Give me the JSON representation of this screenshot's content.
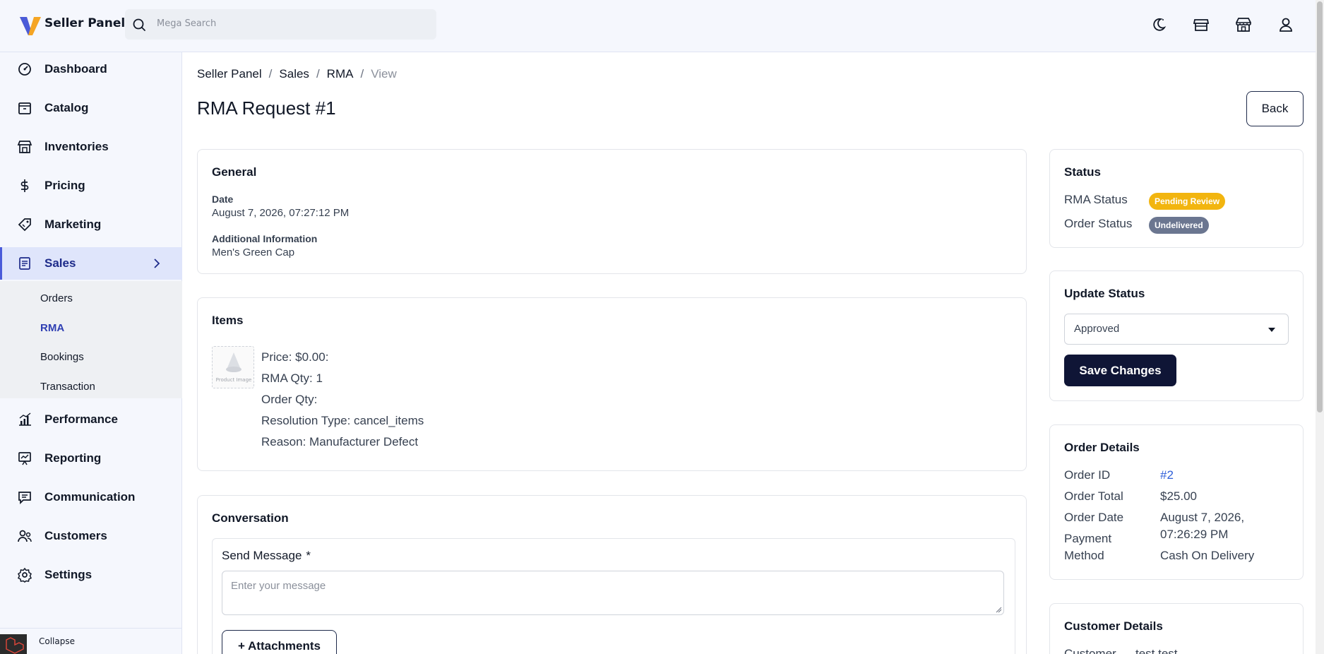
{
  "app": {
    "brand": "Seller Panel"
  },
  "search": {
    "placeholder": "Mega Search"
  },
  "sidebar": {
    "items": [
      {
        "label": "Dashboard"
      },
      {
        "label": "Catalog"
      },
      {
        "label": "Inventories"
      },
      {
        "label": "Pricing"
      },
      {
        "label": "Marketing"
      },
      {
        "label": "Sales"
      },
      {
        "label": "Performance"
      },
      {
        "label": "Reporting"
      },
      {
        "label": "Communication"
      },
      {
        "label": "Customers"
      },
      {
        "label": "Settings"
      }
    ],
    "sub_items": [
      {
        "label": "Orders"
      },
      {
        "label": "RMA"
      },
      {
        "label": "Bookings"
      },
      {
        "label": "Transaction"
      }
    ],
    "collapse_label": "Collapse"
  },
  "breadcrumb": [
    "Seller Panel",
    "Sales",
    "RMA",
    "View"
  ],
  "page": {
    "title": "RMA Request #1",
    "back_label": "Back"
  },
  "general": {
    "title": "General",
    "date_label": "Date",
    "date_value": "August 7, 2026, 07:27:12 PM",
    "info_label": "Additional Information",
    "info_value": "Men's Green Cap"
  },
  "items": {
    "title": "Items",
    "image_placeholder": "Product Image",
    "price": "Price: $0.00:",
    "rma_qty": "RMA Qty: 1",
    "order_qty": "Order Qty:",
    "resolution": "Resolution Type: cancel_items",
    "reason": "Reason: Manufacturer Defect"
  },
  "conversation": {
    "title": "Conversation",
    "send_label": "Send Message",
    "required_mark": "*",
    "placeholder": "Enter your message",
    "attach_label": "+ Attachments"
  },
  "status": {
    "title": "Status",
    "rma_label": "RMA Status",
    "rma_value": "Pending Review",
    "order_label": "Order Status",
    "order_value": "Undelivered",
    "rma_color": "#f2b50f",
    "order_color": "#6b7690"
  },
  "update_status": {
    "title": "Update Status",
    "selected": "Approved",
    "save_label": "Save Changes"
  },
  "order_details": {
    "title": "Order Details",
    "id_label": "Order ID",
    "id_value": "#2",
    "total_label": "Order Total",
    "total_value": "$25.00",
    "date_label": "Order Date",
    "date_value_1": "August 7, 2026,",
    "date_value_2": "07:26:29 PM",
    "payment_label_1": "Payment",
    "payment_label_2": "Method",
    "payment_value": "Cash On Delivery"
  },
  "customer_details": {
    "title": "Customer Details",
    "customer_label": "Customer",
    "customer_value": "test test"
  }
}
